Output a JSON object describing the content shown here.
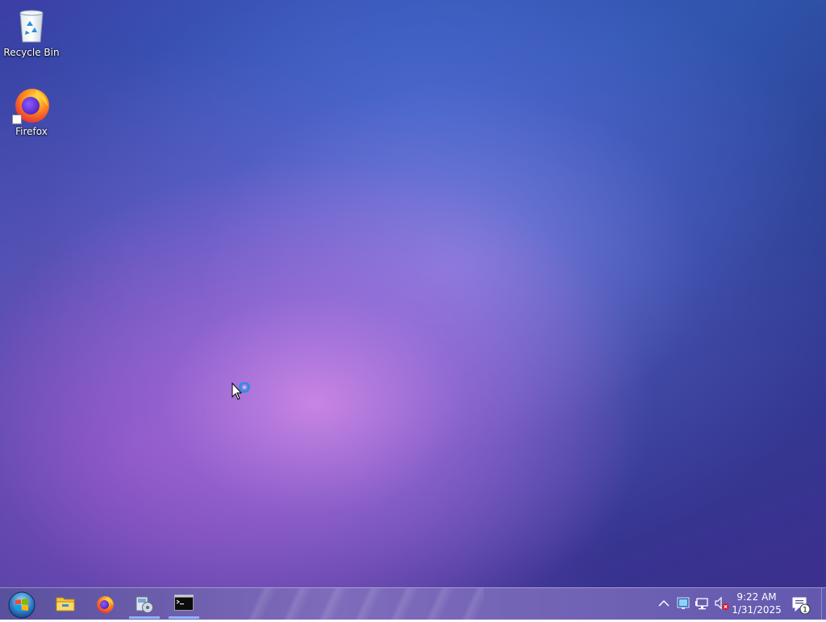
{
  "desktop": {
    "icons": [
      {
        "label": "Recycle Bin",
        "icon": "recycle-bin-icon"
      },
      {
        "label": "Firefox",
        "icon": "firefox-icon",
        "shortcut": true
      }
    ]
  },
  "taskbar": {
    "start": {
      "icon": "windows-start-orb-icon"
    },
    "pinned": [
      {
        "icon": "file-explorer-icon",
        "active": false
      },
      {
        "icon": "firefox-icon",
        "active": false
      },
      {
        "icon": "installer-disk-icon",
        "active": true
      },
      {
        "icon": "command-prompt-icon",
        "active": true
      }
    ],
    "tray": {
      "icons": [
        "show-hidden-icons-chevron-icon",
        "network-monitor-icon",
        "network-icon",
        "volume-muted-icon"
      ],
      "time": "9:22 AM",
      "date": "1/31/2025",
      "notification_count": "1"
    }
  },
  "colors": {
    "wallpaper_center": "#c98ae6",
    "wallpaper_edge": "#2f3f96",
    "active_indicator": "#8fb4ff"
  }
}
